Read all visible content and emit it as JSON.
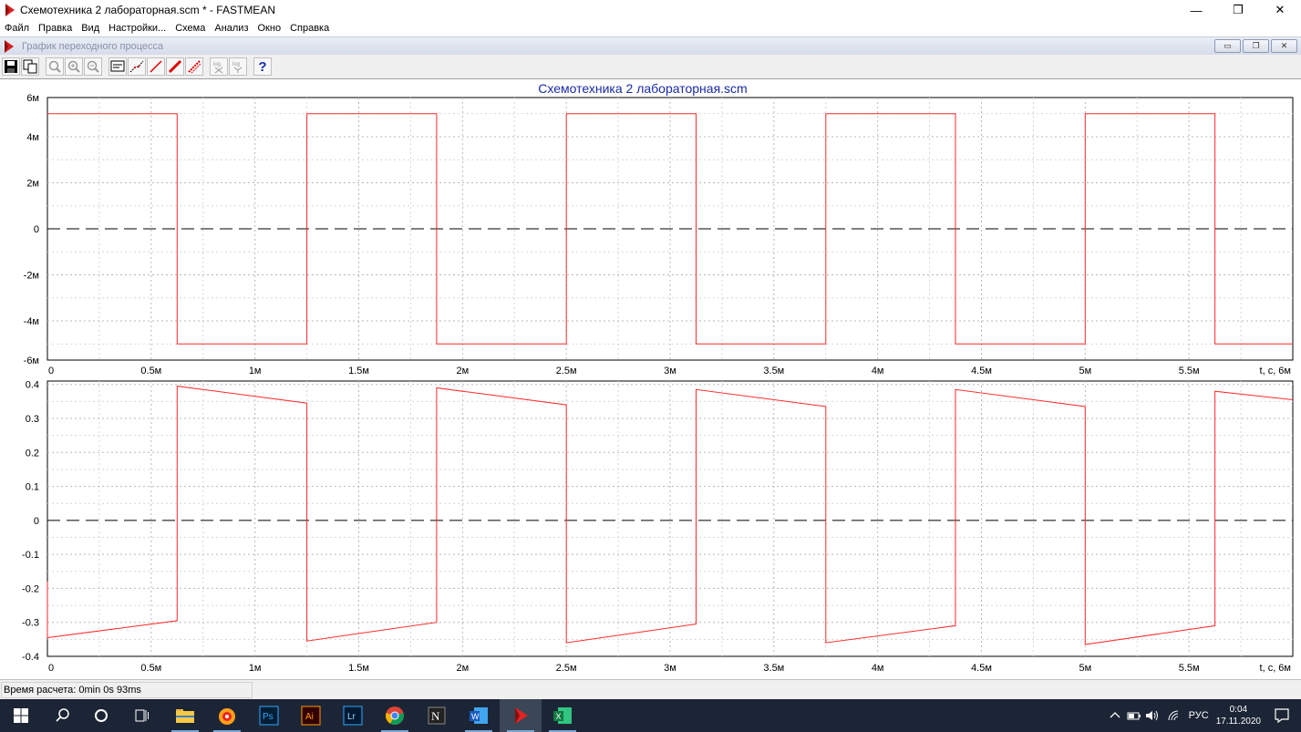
{
  "window": {
    "title": "Схемотехника 2 лабораторная.scm * - FASTMEAN",
    "minimize": "—",
    "restore": "❐",
    "close": "✕"
  },
  "menu": [
    "Файл",
    "Правка",
    "Вид",
    "Настройки...",
    "Схема",
    "Анализ",
    "Окно",
    "Справка"
  ],
  "mdi": {
    "caption": "График переходного процесса"
  },
  "toolbar": {
    "help_label": "?",
    "log_label": "log"
  },
  "status": {
    "calc_time": "Время расчета: 0min 0s 93ms"
  },
  "taskbar": {
    "lang": "РУС",
    "time": "0:04",
    "date": "17.11.2020"
  },
  "chart_data": [
    {
      "type": "line",
      "title": "Схемотехника 2 лабораторная.scm",
      "xlabel": "t, с",
      "xlim": [
        0,
        0.006
      ],
      "ylim": [
        -0.0057,
        0.0057
      ],
      "x_ticks": [
        "0",
        "0.5м",
        "1м",
        "1.5м",
        "2м",
        "2.5м",
        "3м",
        "3.5м",
        "4м",
        "4.5м",
        "5м",
        "5.5м",
        "6м"
      ],
      "y_ticks": [
        "6м",
        "4м",
        "2м",
        "0",
        "-2м",
        "-4м",
        "-6м"
      ],
      "y_tick_values": [
        0.006,
        0.004,
        0.002,
        0,
        -0.002,
        -0.004,
        -0.006
      ],
      "series": [
        {
          "color": "#ff2a2a",
          "x": [
            0,
            0.000625,
            0.000625,
            0.00125,
            0.00125,
            0.001875,
            0.001875,
            0.0025,
            0.0025,
            0.003125,
            0.003125,
            0.00375,
            0.00375,
            0.004375,
            0.004375,
            0.005,
            0.005,
            0.005625,
            0.005625,
            0.006
          ],
          "y": [
            0.005,
            0.005,
            -0.005,
            -0.005,
            0.005,
            0.005,
            -0.005,
            -0.005,
            0.005,
            0.005,
            -0.005,
            -0.005,
            0.005,
            0.005,
            -0.005,
            -0.005,
            0.005,
            0.005,
            -0.005,
            -0.005
          ]
        }
      ],
      "zero_line": "dashed"
    },
    {
      "type": "line",
      "xlabel": "t, с",
      "xlim": [
        0,
        0.006
      ],
      "ylim": [
        -0.4,
        0.41
      ],
      "x_ticks": [
        "0",
        "0.5м",
        "1м",
        "1.5м",
        "2м",
        "2.5м",
        "3м",
        "3.5м",
        "4м",
        "4.5м",
        "5м",
        "5.5м",
        "6м"
      ],
      "y_ticks": [
        "0.4",
        "0.3",
        "0.2",
        "0.1",
        "0",
        "-0.1",
        "-0.2",
        "-0.3",
        "-0.4"
      ],
      "y_tick_values": [
        0.4,
        0.3,
        0.2,
        0.1,
        0,
        -0.1,
        -0.2,
        -0.3,
        -0.4
      ],
      "series": [
        {
          "color": "#ff2a2a",
          "x": [
            0,
            0,
            0.000625,
            0.000625,
            0.00125,
            0.00125,
            0.001875,
            0.001875,
            0.0025,
            0.0025,
            0.003125,
            0.003125,
            0.00375,
            0.00375,
            0.004375,
            0.004375,
            0.005,
            0.005,
            0.005625,
            0.005625,
            0.006
          ],
          "y": [
            -0.18,
            -0.345,
            -0.295,
            0.395,
            0.345,
            -0.355,
            -0.3,
            0.39,
            0.34,
            -0.36,
            -0.305,
            0.385,
            0.335,
            -0.36,
            -0.31,
            0.385,
            0.335,
            -0.365,
            -0.31,
            0.38,
            0.355
          ]
        }
      ],
      "zero_line": "dashed"
    }
  ]
}
